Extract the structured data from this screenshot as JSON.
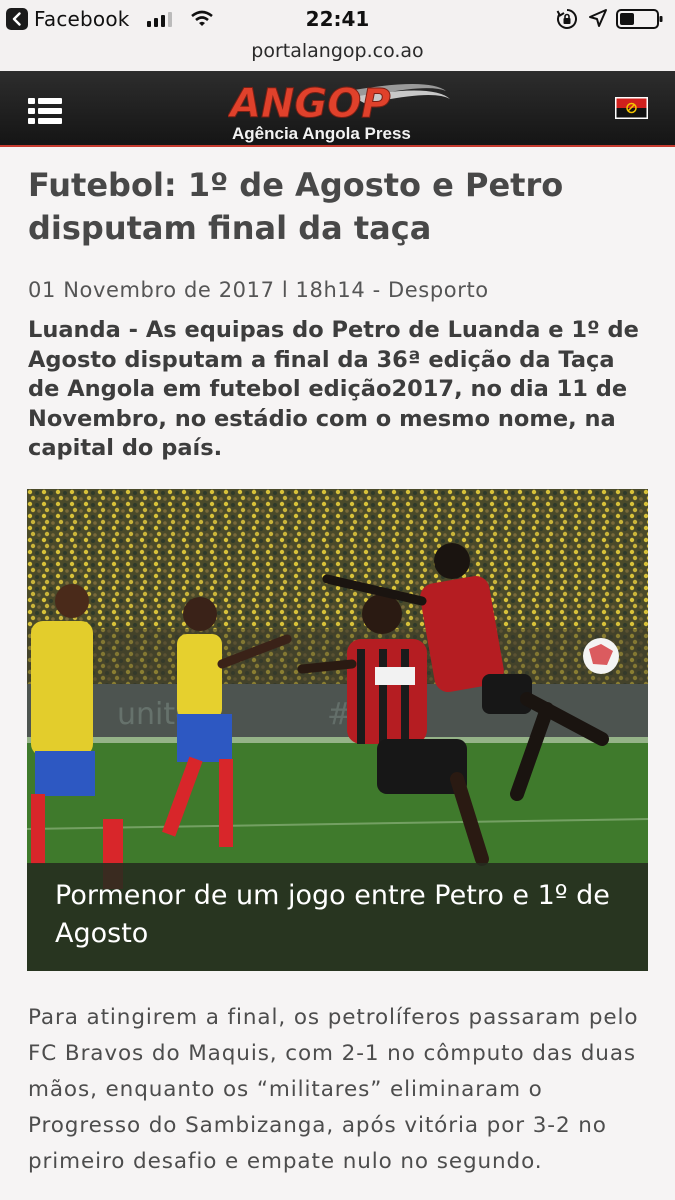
{
  "status_bar": {
    "back_app": "Facebook",
    "time": "22:41"
  },
  "url_bar": {
    "domain": "portalangop.co.ao"
  },
  "header": {
    "logo_name": "ANGOP",
    "logo_tagline": "Agência Angola Press",
    "menu_icon": "hamburger-menu-icon",
    "language_icon": "angola-flag-icon"
  },
  "article": {
    "title": "Futebol: 1º de Agosto e Petro disputam final da taça",
    "dateline": "01 Novembro de 2017 l 18h14 - Desporto",
    "lead": "Luanda - As equipas do Petro de Luanda e 1º de Agosto disputam a final da 36ª edição da Taça de Angola em futebol edição2017, no dia 11 de Novembro, no estádio com o mesmo nome, na capital do país.",
    "photo_caption": "Pormenor de um jogo entre Petro e 1º de Agosto",
    "paragraph_1": "Para atingirem a final, os petrolíferos passaram pelo FC Bravos do Maquis, com 2-1 no cômputo das duas mãos, enquanto os “militares” eliminaram o Progresso do Sambizanga, após vitória por 3-2 no primeiro desafio e empate nulo no segundo."
  },
  "colors": {
    "header_bg": "#1e1e1e",
    "logo_red": "#e0412b",
    "accent_line": "#c63b2f",
    "title_text": "#484848"
  }
}
